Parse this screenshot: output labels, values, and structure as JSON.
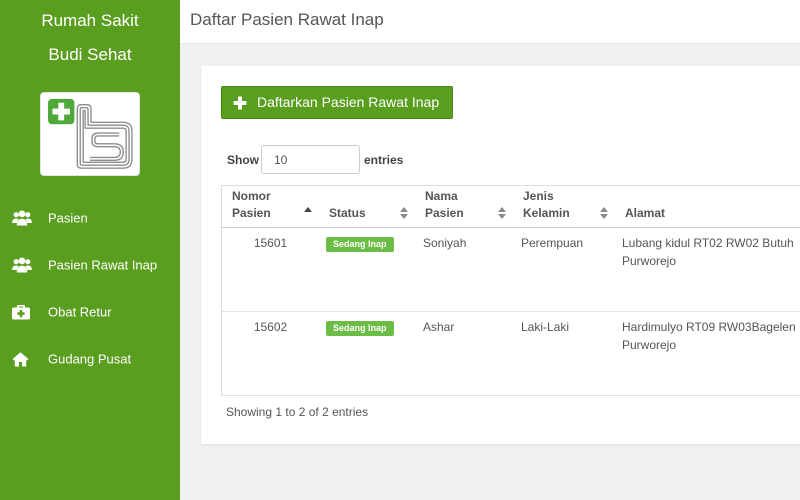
{
  "sidebar": {
    "title_line1": "Rumah Sakit",
    "title_line2": "Budi Sehat",
    "logo_icon": "hospital-logo",
    "items": [
      {
        "label": "Pasien",
        "icon": "users-icon"
      },
      {
        "label": "Pasien Rawat Inap",
        "icon": "users-icon"
      },
      {
        "label": "Obat Retur",
        "icon": "medkit-icon"
      },
      {
        "label": "Gudang Pusat",
        "icon": "home-icon"
      }
    ]
  },
  "header": {
    "title": "Daftar Pasien Rawat Inap"
  },
  "toolbar": {
    "add_button_label": "Daftarkan Pasien Rawat Inap",
    "add_button_icon": "plus-icon"
  },
  "length_control": {
    "show_label": "Show",
    "value": "10",
    "entries_label": "entries"
  },
  "table": {
    "columns": [
      {
        "label": "Nomor Pasien",
        "sort_icon": "sort-asc-icon"
      },
      {
        "label": "Status",
        "sort_icon": "sort-icon"
      },
      {
        "label": "Nama Pasien",
        "sort_icon": "sort-icon"
      },
      {
        "label": "Jenis Kelamin",
        "sort_icon": "sort-icon"
      },
      {
        "label": "Alamat"
      }
    ],
    "rows": [
      {
        "nomor": "15601",
        "status": "Sedang Inap",
        "nama": "Soniyah",
        "jenis_kelamin": "Perempuan",
        "alamat": "Lubang kidul RT02 RW02 Butuh Purworejo"
      },
      {
        "nomor": "15602",
        "status": "Sedang Inap",
        "nama": "Ashar",
        "jenis_kelamin": "Laki-Laki",
        "alamat": "Hardimulyo RT09 RW03Bagelen Purworejo"
      }
    ]
  },
  "info": "Showing 1 to 2 of 2 entries",
  "colors": {
    "sidebar_bg": "#5a9e1f",
    "button_bg": "#5a9e1f",
    "button_border": "#4a8816",
    "badge_bg": "#6cbd45",
    "page_bg": "#f1f1f1"
  }
}
